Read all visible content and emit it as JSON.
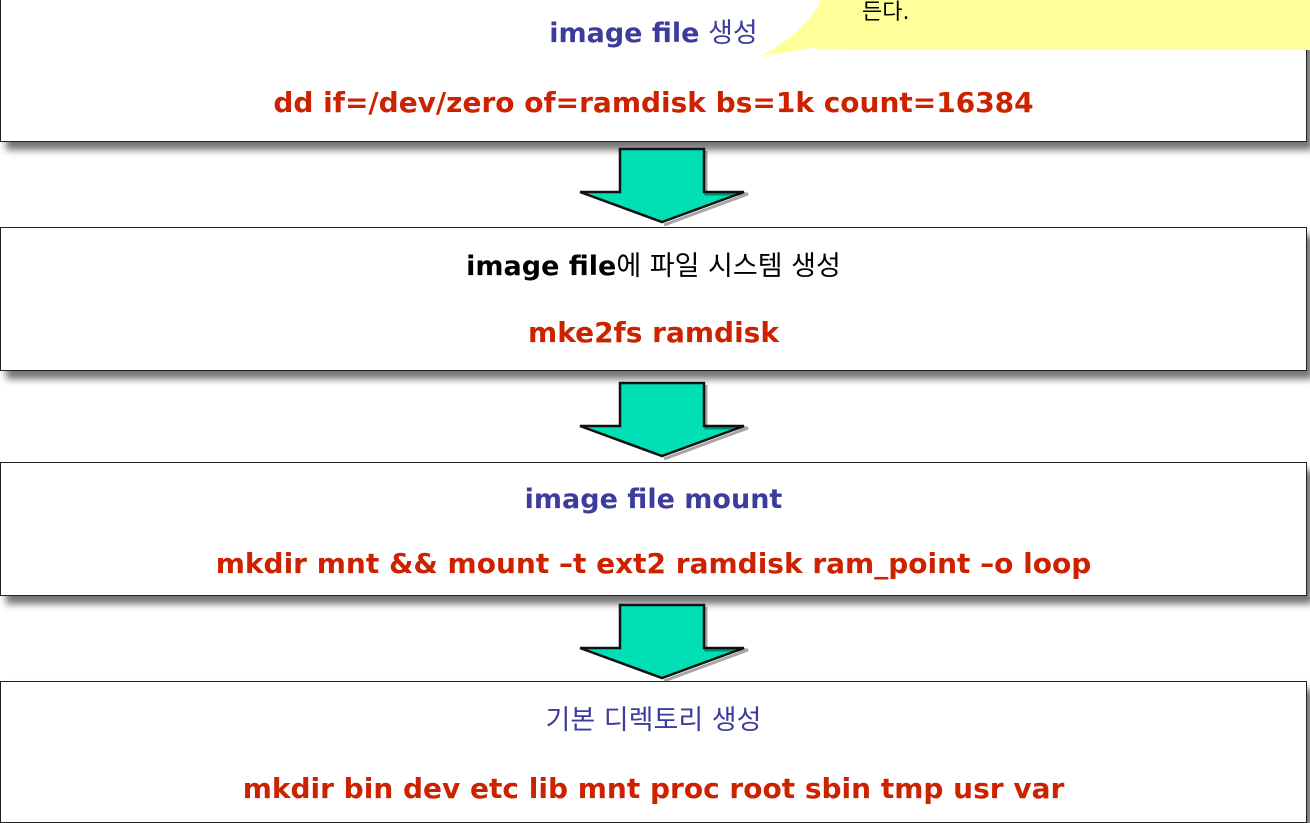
{
  "callout": {
    "text": "든다."
  },
  "steps": [
    {
      "title_bold": "image file",
      "title_rest": " 생성",
      "command": "dd if=/dev/zero of=ramdisk bs=1k count=16384"
    },
    {
      "title_bold": "image file",
      "title_rest": "에 파일 시스템 생성",
      "command": "mke2fs ramdisk"
    },
    {
      "title_bold": "image file mount",
      "title_rest": "",
      "command": "mkdir mnt && mount –t ext2 ramdisk ram_point –o loop"
    },
    {
      "title_bold": "",
      "title_rest": "기본 디렉토리 생성",
      "command": "mkdir bin dev etc lib mnt proc root sbin tmp usr var"
    }
  ],
  "colors": {
    "title_blue": "#3c3c9c",
    "command_red": "#cc2200",
    "arrow_fill": "#00e0b4",
    "callout_fill": "#ffff99"
  }
}
